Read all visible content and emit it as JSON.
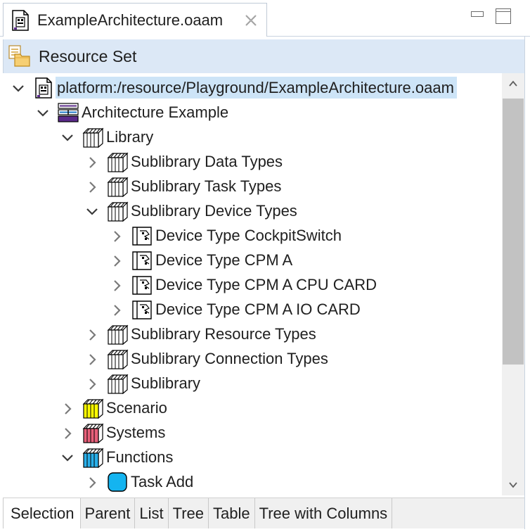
{
  "editor_tab": {
    "title": "ExampleArchitecture.oaam"
  },
  "header": {
    "label": "Resource Set"
  },
  "tree": {
    "rows": [
      {
        "label": "platform:/resource/Playground/ExampleArchitecture.oaam",
        "level": 0,
        "twisty": "expanded",
        "icon": "model-file-icon",
        "selected": true
      },
      {
        "label": "Architecture Example",
        "level": 1,
        "twisty": "expanded",
        "icon": "architecture-icon"
      },
      {
        "label": "Library",
        "level": 2,
        "twisty": "expanded",
        "icon": "library-icon"
      },
      {
        "label": "Sublibrary Data Types",
        "level": 3,
        "twisty": "collapsed",
        "icon": "sublibrary-icon"
      },
      {
        "label": "Sublibrary Task Types",
        "level": 3,
        "twisty": "collapsed",
        "icon": "sublibrary-icon"
      },
      {
        "label": "Sublibrary Device Types",
        "level": 3,
        "twisty": "expanded",
        "icon": "sublibrary-icon"
      },
      {
        "label": "Device Type CockpitSwitch",
        "level": 4,
        "twisty": "collapsed",
        "icon": "device-type-icon"
      },
      {
        "label": "Device Type CPM A",
        "level": 4,
        "twisty": "collapsed",
        "icon": "device-type-icon"
      },
      {
        "label": "Device Type CPM A CPU CARD",
        "level": 4,
        "twisty": "collapsed",
        "icon": "device-type-icon"
      },
      {
        "label": "Device Type CPM A IO CARD",
        "level": 4,
        "twisty": "collapsed",
        "icon": "device-type-icon"
      },
      {
        "label": "Sublibrary Resource Types",
        "level": 3,
        "twisty": "collapsed",
        "icon": "sublibrary-icon"
      },
      {
        "label": "Sublibrary Connection Types",
        "level": 3,
        "twisty": "collapsed",
        "icon": "sublibrary-icon"
      },
      {
        "label": "Sublibrary",
        "level": 3,
        "twisty": "collapsed",
        "icon": "sublibrary-icon"
      },
      {
        "label": "Scenario",
        "level": 2,
        "twisty": "collapsed",
        "icon": "scenario-icon"
      },
      {
        "label": "Systems",
        "level": 2,
        "twisty": "collapsed",
        "icon": "systems-icon"
      },
      {
        "label": "Functions",
        "level": 2,
        "twisty": "expanded",
        "icon": "functions-icon"
      },
      {
        "label": "Task Add",
        "level": 3,
        "twisty": "collapsed",
        "icon": "task-icon"
      }
    ]
  },
  "bottom_tabs": [
    {
      "label": "Selection",
      "active": true
    },
    {
      "label": "Parent"
    },
    {
      "label": "List"
    },
    {
      "label": "Tree"
    },
    {
      "label": "Table"
    },
    {
      "label": "Tree with Columns"
    }
  ],
  "colors": {
    "selection": "#cde4f7",
    "header_bg": "#dce8f6",
    "scenario": "#ffff00",
    "systems": "#e8607a",
    "functions": "#2ab0ea",
    "task": "#14b4f0"
  }
}
